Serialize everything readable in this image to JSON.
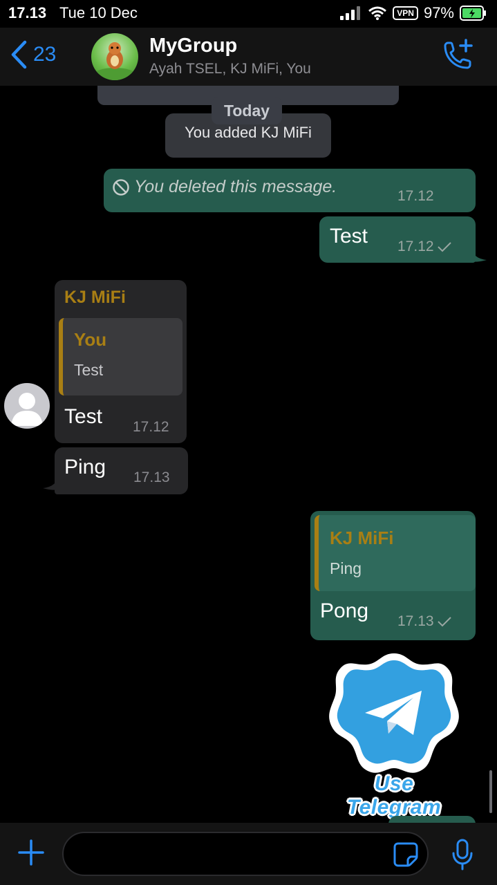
{
  "status_bar": {
    "time": "17.13",
    "date": "Tue 10 Dec",
    "vpn": "VPN",
    "battery": "97%"
  },
  "header": {
    "back_count": "23",
    "group_name": "MyGroup",
    "members": "Ayah TSEL, KJ MiFi, You",
    "icons": {
      "back": "chevron-left-icon",
      "call": "add-call-icon"
    }
  },
  "chat": {
    "date_separator": "Today",
    "system_message": "You added KJ MiFi",
    "messages": [
      {
        "id": "deleted",
        "text": "You deleted this message.",
        "time": "17.12"
      },
      {
        "id": "test_out",
        "text": "Test",
        "time": "17.12",
        "status": "sent"
      },
      {
        "id": "test_in",
        "sender": "KJ MiFi",
        "quote_sender": "You",
        "quote_text": "Test",
        "text": "Test",
        "time": "17.12"
      },
      {
        "id": "ping_in",
        "text": "Ping",
        "time": "17.13"
      },
      {
        "id": "pong_out",
        "quote_sender": "KJ MiFi",
        "quote_text": "Ping",
        "text": "Pong",
        "time": "17.13",
        "status": "sent"
      }
    ],
    "sticker": {
      "text": "Use Telegram",
      "icon": "telegram-icon"
    }
  },
  "composer": {
    "placeholder": "",
    "icons": {
      "attach": "plus-icon",
      "sticker": "sticker-icon",
      "mic": "microphone-icon"
    }
  },
  "colors": {
    "accent": "#2a8cf5",
    "outgoing_bubble": "#265c4e",
    "incoming_bubble": "#262628",
    "sender_name": "#a97f14"
  }
}
